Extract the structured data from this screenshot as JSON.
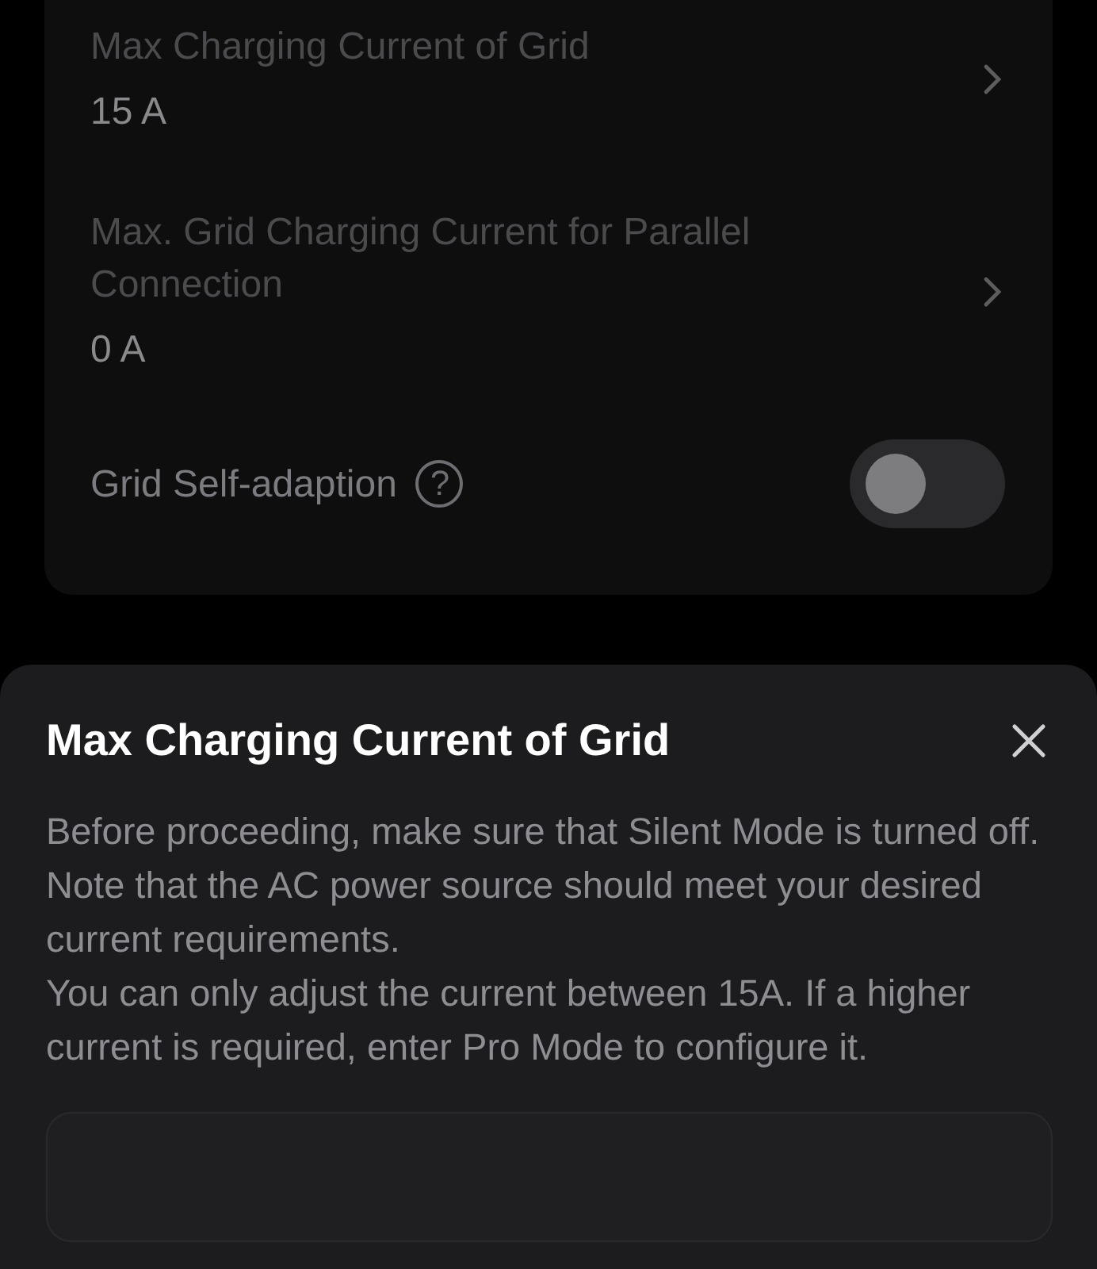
{
  "settings": [
    {
      "kind": "link",
      "label": "Max Charging Current of Grid",
      "value": "15 A"
    },
    {
      "kind": "link",
      "label": "Max. Grid Charging Current for Parallel Connection",
      "value": "0 A"
    },
    {
      "kind": "toggle",
      "label": "Grid Self-adaption",
      "help": "?",
      "on": false
    }
  ],
  "sheet": {
    "title": "Max Charging Current of Grid",
    "paragraphs": [
      "Before proceeding, make sure that Silent Mode is turned off.",
      "Note that the AC power source should meet your desired current requirements.",
      "You can only adjust the current between 15A. If a higher current is required, enter Pro Mode to configure it."
    ]
  }
}
